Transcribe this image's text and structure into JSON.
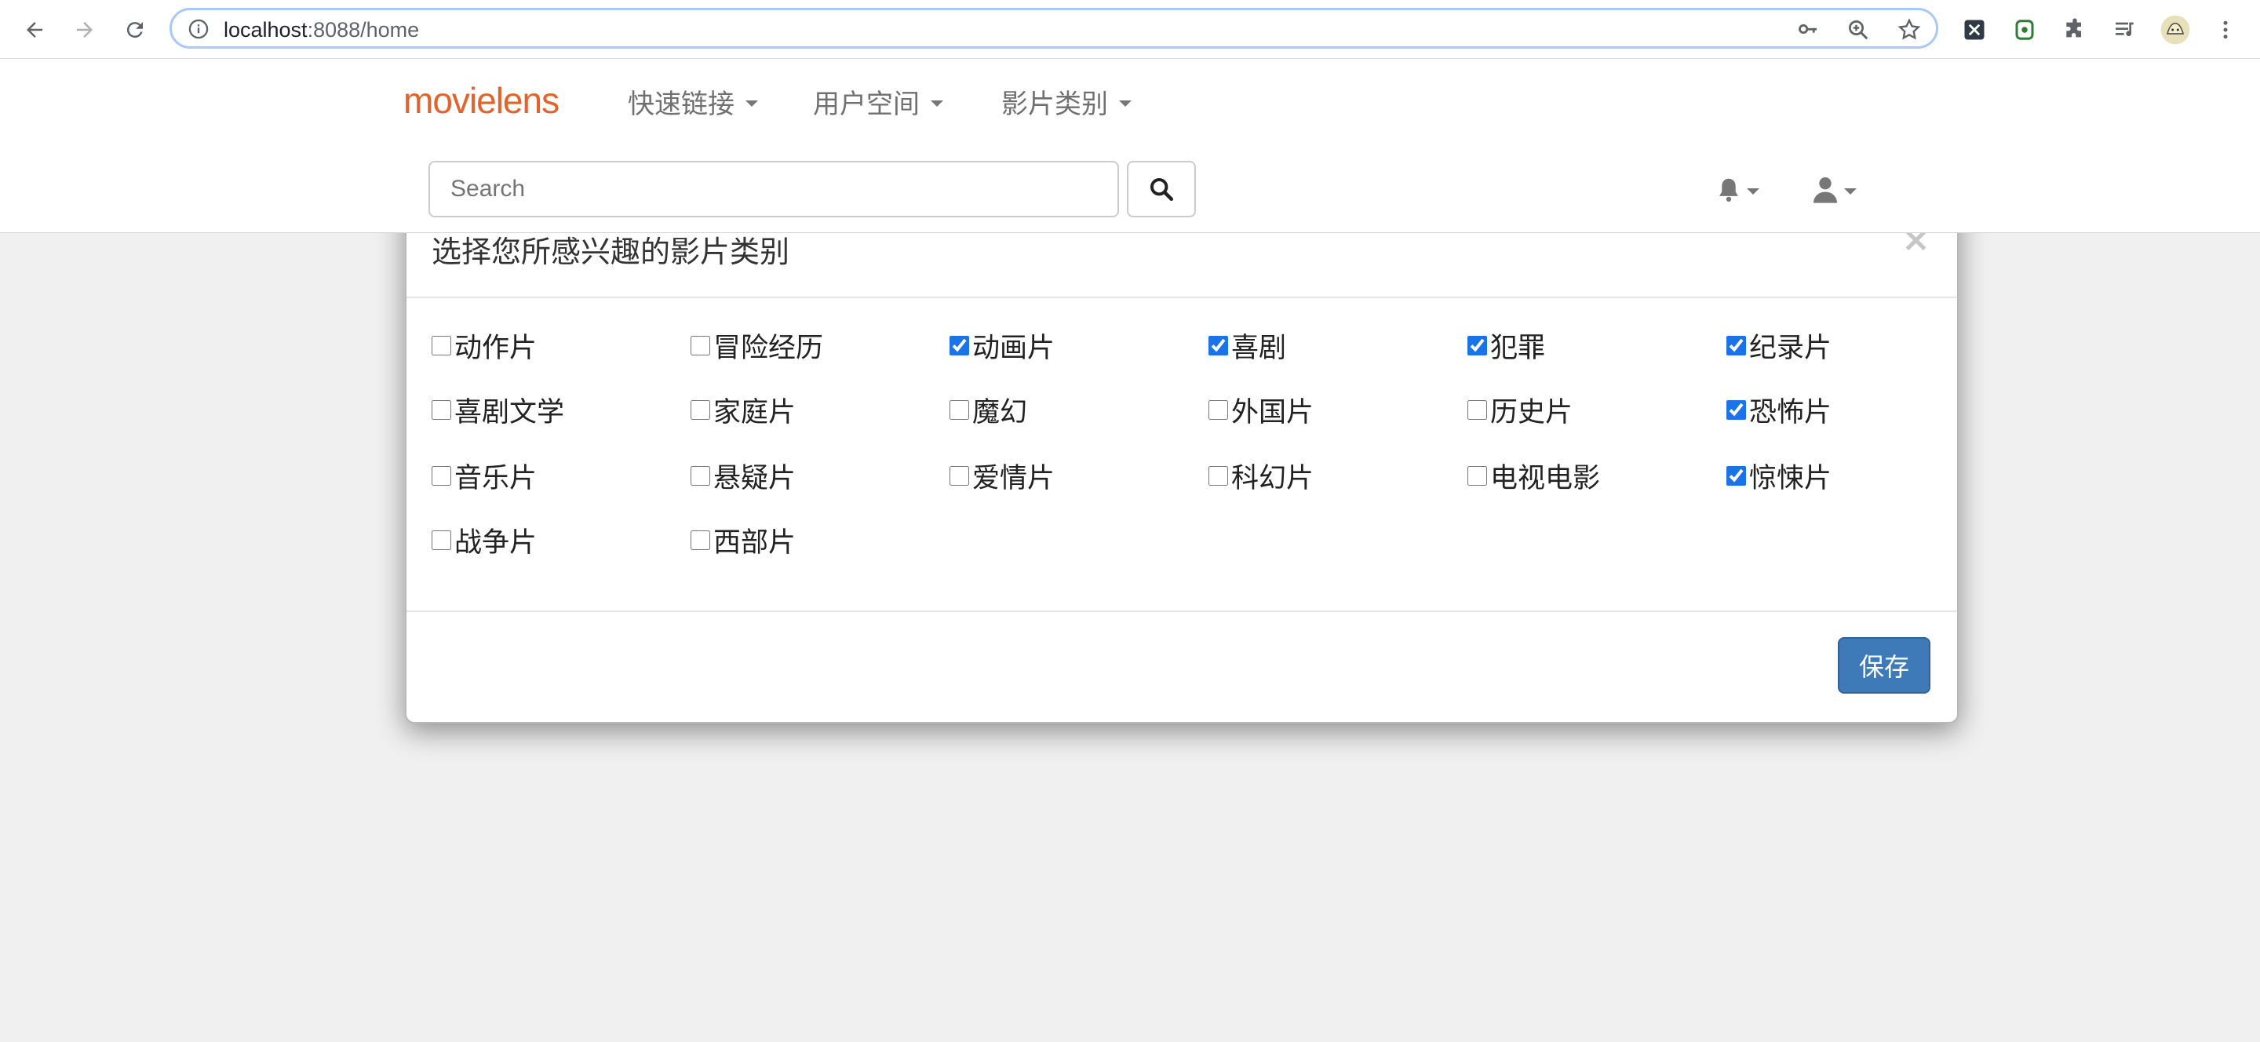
{
  "browser": {
    "url_host": "localhost",
    "url_rest": ":8088/home"
  },
  "app": {
    "logo": "movielens",
    "menus": [
      {
        "label": "快速链接"
      },
      {
        "label": "用户空间"
      },
      {
        "label": "影片类别"
      }
    ],
    "search": {
      "placeholder": "Search",
      "value": ""
    }
  },
  "modal": {
    "title": "选择您所感兴趣的影片类别",
    "close_symbol": "×",
    "genres": [
      {
        "label": "动作片",
        "checked": false
      },
      {
        "label": "冒险经历",
        "checked": false
      },
      {
        "label": "动画片",
        "checked": true
      },
      {
        "label": "喜剧",
        "checked": true
      },
      {
        "label": "犯罪",
        "checked": true
      },
      {
        "label": "纪录片",
        "checked": true
      },
      {
        "label": "喜剧文学",
        "checked": false
      },
      {
        "label": "家庭片",
        "checked": false
      },
      {
        "label": "魔幻",
        "checked": false
      },
      {
        "label": "外国片",
        "checked": false
      },
      {
        "label": "历史片",
        "checked": false
      },
      {
        "label": "恐怖片",
        "checked": true
      },
      {
        "label": "音乐片",
        "checked": false
      },
      {
        "label": "悬疑片",
        "checked": false
      },
      {
        "label": "爱情片",
        "checked": false
      },
      {
        "label": "科幻片",
        "checked": false
      },
      {
        "label": "电视电影",
        "checked": false
      },
      {
        "label": "惊悚片",
        "checked": true
      },
      {
        "label": "战争片",
        "checked": false
      },
      {
        "label": "西部片",
        "checked": false
      }
    ],
    "save_label": "保存"
  }
}
